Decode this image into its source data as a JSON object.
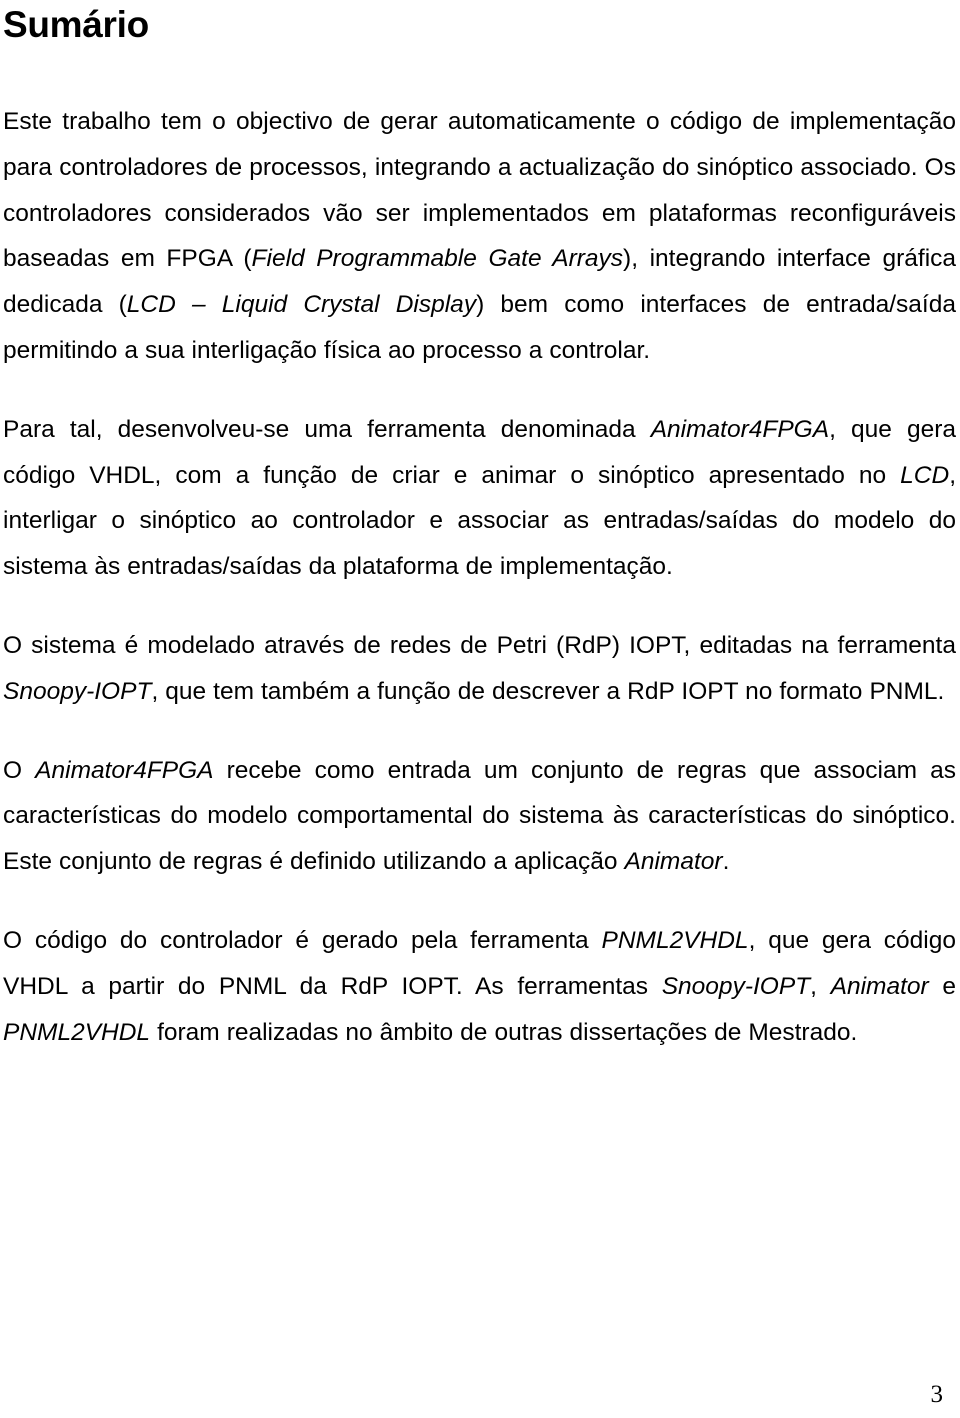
{
  "document": {
    "heading": "Sumário",
    "page_number": "3",
    "language": "pt-PT",
    "paragraphs": [
      {
        "id": "p1",
        "runs": [
          {
            "style": "normal",
            "text": "Este trabalho tem o objectivo de gerar automaticamente o código de implementação para controladores de processos, integrando a actualização do sinóptico associado. Os controladores considerados vão ser implementados em plataformas reconfiguráveis baseadas em FPGA ("
          },
          {
            "style": "italic",
            "text": "Field Programmable Gate Arrays"
          },
          {
            "style": "normal",
            "text": "), integrando interface gráfica dedicada ("
          },
          {
            "style": "italic",
            "text": "LCD – Liquid Crystal Display"
          },
          {
            "style": "normal",
            "text": ") bem como interfaces de entrada/saída permitindo a sua interligação física ao processo a controlar."
          }
        ]
      },
      {
        "id": "p2",
        "runs": [
          {
            "style": "normal",
            "text": "Para tal, desenvolveu-se uma ferramenta denominada "
          },
          {
            "style": "italic",
            "text": "Animator4FPGA"
          },
          {
            "style": "normal",
            "text": ", que gera código VHDL, com a função de criar e animar o sinóptico apresentado no "
          },
          {
            "style": "italic",
            "text": "LCD"
          },
          {
            "style": "normal",
            "text": ", interligar o sinóptico ao controlador e associar as entradas/saídas do modelo do sistema às entradas/saídas da plataforma de implementação."
          }
        ]
      },
      {
        "id": "p3",
        "runs": [
          {
            "style": "normal",
            "text": "O sistema é modelado através de redes de Petri (RdP) IOPT, editadas na ferramenta "
          },
          {
            "style": "italic",
            "text": "Snoopy-IOPT"
          },
          {
            "style": "normal",
            "text": ", que tem também a função de descrever a RdP IOPT no formato PNML."
          }
        ]
      },
      {
        "id": "p4",
        "runs": [
          {
            "style": "normal",
            "text": "O "
          },
          {
            "style": "italic",
            "text": "Animator4FPGA"
          },
          {
            "style": "normal",
            "text": " recebe como entrada um conjunto de regras que associam as características do modelo comportamental do sistema às características do sinóptico. Este conjunto de regras é definido utilizando a aplicação "
          },
          {
            "style": "italic",
            "text": "Animator"
          },
          {
            "style": "normal",
            "text": "."
          }
        ]
      },
      {
        "id": "p5",
        "runs": [
          {
            "style": "normal",
            "text": "O código do controlador é gerado pela ferramenta "
          },
          {
            "style": "italic",
            "text": "PNML2VHDL"
          },
          {
            "style": "normal",
            "text": ", que gera código VHDL a partir do PNML da RdP IOPT. As ferramentas "
          },
          {
            "style": "italic",
            "text": "Snoopy-IOPT"
          },
          {
            "style": "normal",
            "text": ", "
          },
          {
            "style": "italic",
            "text": "Animator"
          },
          {
            "style": "normal",
            "text": " e "
          },
          {
            "style": "italic",
            "text": "PNML2VHDL"
          },
          {
            "style": "normal",
            "text": " foram realizadas no âmbito de outras dissertações de Mestrado."
          }
        ]
      }
    ]
  }
}
